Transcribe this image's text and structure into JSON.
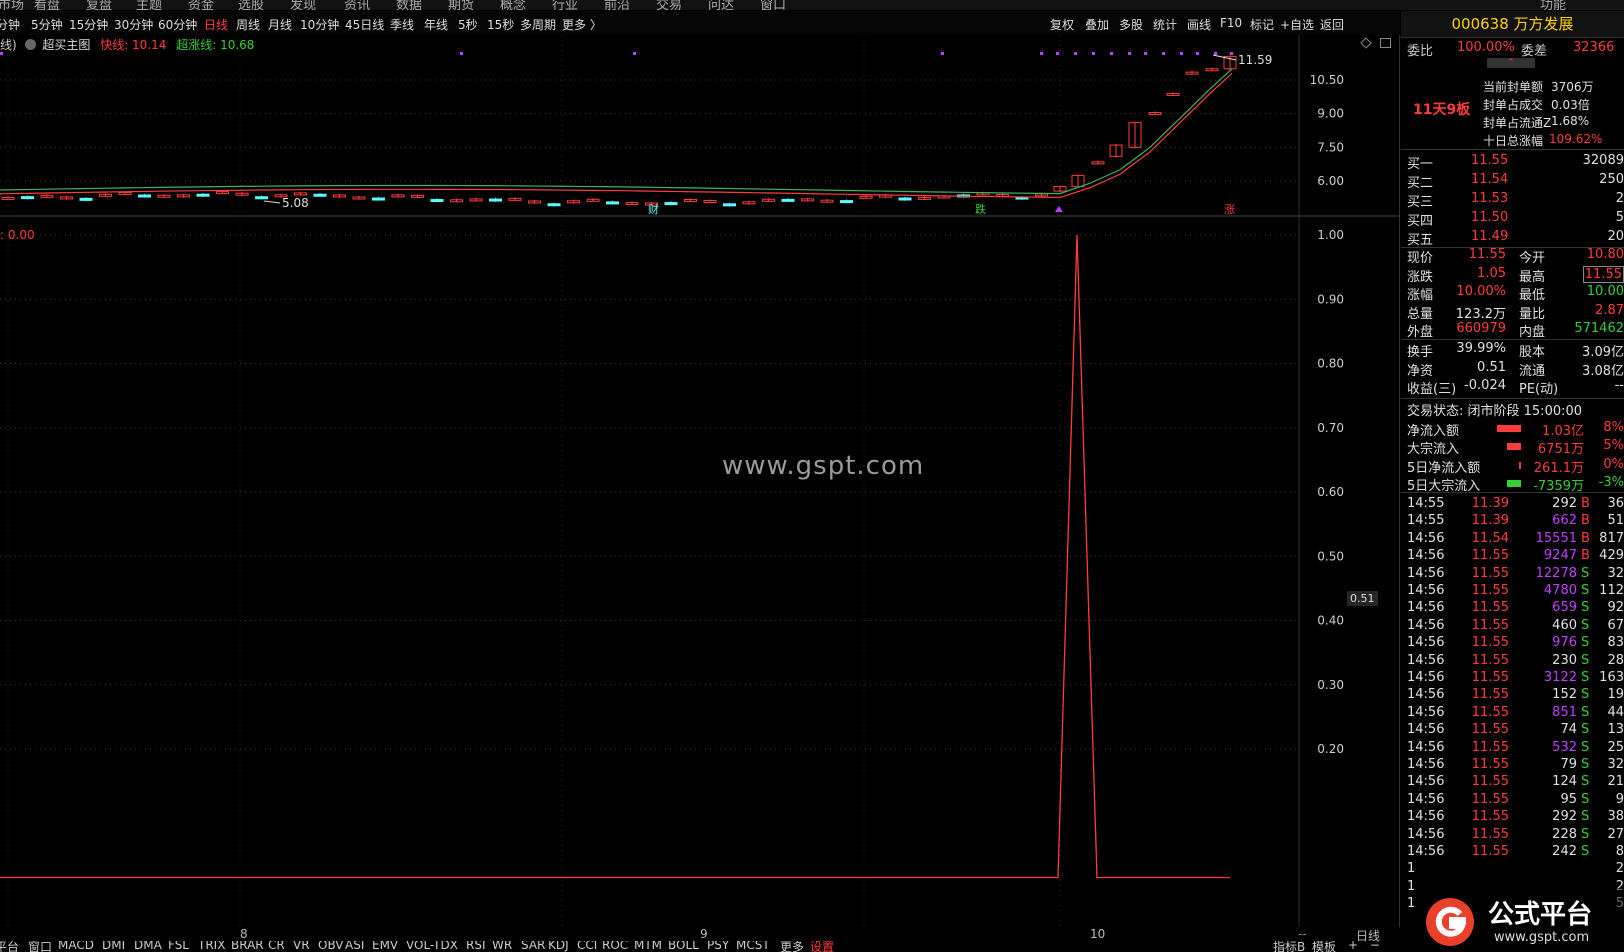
{
  "top_menu": [
    "市场",
    "看盘",
    "复盘",
    "主题",
    "资金",
    "选股",
    "发现",
    "资讯",
    "数据",
    "期货",
    "概念",
    "行业",
    "前沿",
    "交易",
    "问达",
    "窗口",
    "功能"
  ],
  "periods": [
    "分钟",
    "5分钟",
    "15分钟",
    "30分钟",
    "60分钟",
    "日线",
    "周线",
    "月线",
    "10分钟",
    "45日线",
    "季线",
    "年线",
    "5秒",
    "15秒",
    "多周期",
    "更多 〉"
  ],
  "active_period": "日线",
  "toolbar_right": [
    "复权",
    "叠加",
    "多股",
    "统计",
    "画线",
    "F10",
    "标记",
    "+自选",
    "返回"
  ],
  "main_chart": {
    "prefix": "线)",
    "name": "超买主图",
    "fast_label": "快线: 10.14",
    "super_label": "超涨线: 10.68",
    "high_label": "11.59",
    "low_label": "5.08",
    "y_ticks": [
      "10.50",
      "9.00",
      "7.50",
      "6.00"
    ],
    "markers": [
      "财",
      "跌",
      "涨"
    ]
  },
  "indicator": {
    "label": "0.00",
    "current": "0.51",
    "y_ticks": [
      "1.00",
      "0.90",
      "0.80",
      "0.70",
      "0.60",
      "0.50",
      "0.40",
      "0.30",
      "0.20"
    ]
  },
  "watermark": "www.gspt.com",
  "x_axis": [
    "8",
    "9",
    "10"
  ],
  "x_axis_right": "日线",
  "x_axis_dash": "--",
  "bottom_tabs": [
    "平台",
    "窗口",
    "MACD",
    "DMI",
    "DMA",
    "FSL",
    "TRIX",
    "BRAR",
    "CR",
    "VR",
    "OBV",
    "ASI",
    "EMV",
    "VOL-TDX",
    "RSI",
    "WR",
    "SAR",
    "KDJ",
    "CCI",
    "ROC",
    "MTM",
    "BOLL",
    "PSY",
    "MCST",
    "更多",
    "设置"
  ],
  "bottom_tabs_right": [
    "指标B",
    "模板",
    "+",
    "−"
  ],
  "stock": {
    "code": "000638",
    "name": "万方发展",
    "title": "000638 万方发展"
  },
  "weibi": {
    "label": "委比",
    "value": "100.00%",
    "diff_label": "委差",
    "diff_value": "32366"
  },
  "seal": {
    "board": "11天9板",
    "items": [
      {
        "label": "当前封单额",
        "value": "3706万"
      },
      {
        "label": "封单占成交",
        "value": "0.03倍"
      },
      {
        "label": "封单占流通Z",
        "value": "1.68%"
      },
      {
        "label": "十日总涨幅",
        "value": "109.62%"
      }
    ]
  },
  "bids": [
    {
      "label": "买一",
      "price": "11.55",
      "vol": "32089"
    },
    {
      "label": "买二",
      "price": "11.54",
      "vol": "250"
    },
    {
      "label": "买三",
      "price": "11.53",
      "vol": "2"
    },
    {
      "label": "买四",
      "price": "11.50",
      "vol": "5"
    },
    {
      "label": "买五",
      "price": "11.49",
      "vol": "20"
    }
  ],
  "quote": [
    {
      "l1": "现价",
      "v1": "11.55",
      "l2": "今开",
      "v2": "10.80"
    },
    {
      "l1": "涨跌",
      "v1": "1.05",
      "l2": "最高",
      "v2": "11.55"
    },
    {
      "l1": "涨幅",
      "v1": "10.00%",
      "l2": "最低",
      "v2": "10.00"
    },
    {
      "l1": "总量",
      "v1": "123.2万",
      "l2": "量比",
      "v2": "2.87"
    },
    {
      "l1": "外盘",
      "v1": "660979",
      "l2": "内盘",
      "v2": "571462"
    }
  ],
  "fund": [
    {
      "l1": "换手",
      "v1": "39.99%",
      "l2": "股本",
      "v2": "3.09亿"
    },
    {
      "l1": "净资",
      "v1": "0.51",
      "l2": "流通",
      "v2": "3.08亿"
    },
    {
      "l1": "收益(三)",
      "v1": "-0.024",
      "l2": "PE(动)",
      "v2": "--"
    }
  ],
  "status": "交易状态: 闭市阶段 15:00:00",
  "flows": [
    {
      "label": "净流入额",
      "value": "1.03亿",
      "pct": "8%"
    },
    {
      "label": "大宗流入",
      "value": "6751万",
      "pct": "5%"
    },
    {
      "label": "5日净流入额",
      "value": "261.1万",
      "pct": "0%"
    },
    {
      "label": "5日大宗流入",
      "value": "-7359万",
      "pct": "-3%"
    }
  ],
  "ticks": [
    {
      "t": "14:55",
      "p": "11.39",
      "v": "292",
      "s": "B",
      "n": "36"
    },
    {
      "t": "14:55",
      "p": "11.39",
      "v": "662",
      "s": "B",
      "n": "51"
    },
    {
      "t": "14:56",
      "p": "11.54",
      "v": "15551",
      "s": "B",
      "n": "817"
    },
    {
      "t": "14:56",
      "p": "11.55",
      "v": "9247",
      "s": "B",
      "n": "429"
    },
    {
      "t": "14:56",
      "p": "11.55",
      "v": "12278",
      "s": "S",
      "n": "32"
    },
    {
      "t": "14:56",
      "p": "11.55",
      "v": "4780",
      "s": "S",
      "n": "112"
    },
    {
      "t": "14:56",
      "p": "11.55",
      "v": "659",
      "s": "S",
      "n": "92"
    },
    {
      "t": "14:56",
      "p": "11.55",
      "v": "460",
      "s": "S",
      "n": "67"
    },
    {
      "t": "14:56",
      "p": "11.55",
      "v": "976",
      "s": "S",
      "n": "83"
    },
    {
      "t": "14:56",
      "p": "11.55",
      "v": "230",
      "s": "S",
      "n": "28"
    },
    {
      "t": "14:56",
      "p": "11.55",
      "v": "3122",
      "s": "S",
      "n": "163"
    },
    {
      "t": "14:56",
      "p": "11.55",
      "v": "152",
      "s": "S",
      "n": "19"
    },
    {
      "t": "14:56",
      "p": "11.55",
      "v": "851",
      "s": "S",
      "n": "44"
    },
    {
      "t": "14:56",
      "p": "11.55",
      "v": "74",
      "s": "S",
      "n": "13"
    },
    {
      "t": "14:56",
      "p": "11.55",
      "v": "532",
      "s": "S",
      "n": "25"
    },
    {
      "t": "14:56",
      "p": "11.55",
      "v": "79",
      "s": "S",
      "n": "32"
    },
    {
      "t": "14:56",
      "p": "11.55",
      "v": "124",
      "s": "S",
      "n": "21"
    },
    {
      "t": "14:56",
      "p": "11.55",
      "v": "95",
      "s": "S",
      "n": "9"
    },
    {
      "t": "14:56",
      "p": "11.55",
      "v": "292",
      "s": "S",
      "n": "38"
    },
    {
      "t": "14:56",
      "p": "11.55",
      "v": "228",
      "s": "S",
      "n": "27"
    },
    {
      "t": "14:56",
      "p": "11.55",
      "v": "242",
      "s": "S",
      "n": "8"
    },
    {
      "t": "1",
      "p": "",
      "v": "",
      "s": "",
      "n": "2"
    },
    {
      "t": "1",
      "p": "",
      "v": "",
      "s": "",
      "n": "2"
    },
    {
      "t": "1",
      "p": "",
      "v": "",
      "s": "",
      "n": "5"
    }
  ],
  "logo": {
    "text": "公式平台",
    "url": "www.gspt.com"
  },
  "colors": {
    "up": "#ff3c3c",
    "down": "#54ffff",
    "ma_green": "#3cb45a",
    "ma_red": "#ff3c3c",
    "price_yellow": "#ffd000",
    "purple": "#c040ff"
  }
}
